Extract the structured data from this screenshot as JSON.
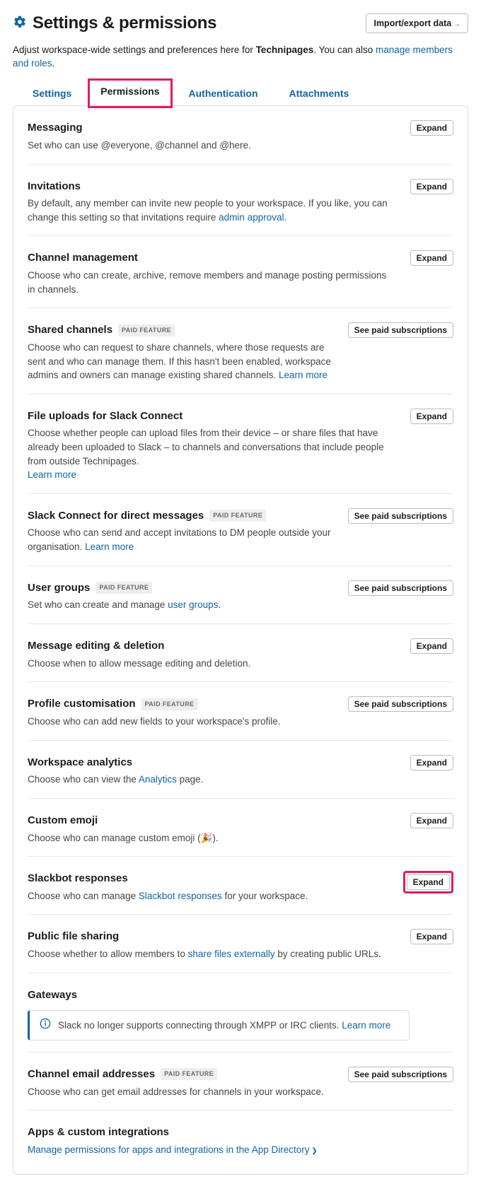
{
  "header": {
    "title": "Settings & permissions",
    "import_export_label": "Import/export data"
  },
  "subhead": {
    "prefix": "Adjust workspace-wide settings and preferences here for ",
    "workspace": "Technipages",
    "suffix": ". You can also ",
    "link": "manage members and roles",
    "period": "."
  },
  "tabs": {
    "settings": "Settings",
    "permissions": "Permissions",
    "authentication": "Authentication",
    "attachments": "Attachments"
  },
  "buttons": {
    "expand": "Expand",
    "see_paid": "See paid subscriptions"
  },
  "badges": {
    "paid": "PAID FEATURE"
  },
  "sections": {
    "messaging": {
      "title": "Messaging",
      "desc": "Set who can use @everyone, @channel and @here."
    },
    "invitations": {
      "title": "Invitations",
      "desc_before": "By default, any member can invite new people to your workspace. If you like, you can change this setting so that invitations require ",
      "link": "admin approval",
      "desc_after": "."
    },
    "channel_mgmt": {
      "title": "Channel management",
      "desc": "Choose who can create, archive, remove members and manage posting permissions in channels."
    },
    "shared_channels": {
      "title": "Shared channels",
      "desc_before": "Choose who can request to share channels, where those requests are sent and who can manage them. If this hasn't been enabled, workspace admins and owners can manage existing shared channels. ",
      "link": "Learn more"
    },
    "file_uploads": {
      "title": "File uploads for Slack Connect",
      "desc_before": "Choose whether people can upload files from their device – or share files that have already been uploaded to Slack – to channels and conversations that include people from outside ",
      "bold": "Technipages",
      "desc_after": ".",
      "link": "Learn more"
    },
    "slack_connect_dm": {
      "title": "Slack Connect for direct messages",
      "desc_before": "Choose who can send and accept invitations to DM people outside your organisation. ",
      "link": "Learn more"
    },
    "user_groups": {
      "title": "User groups",
      "desc_before": "Set who can create and manage ",
      "link": "user groups",
      "desc_after": "."
    },
    "msg_edit": {
      "title": "Message editing & deletion",
      "desc": "Choose when to allow message editing and deletion."
    },
    "profile": {
      "title": "Profile customisation",
      "desc": "Choose who can add new fields to your workspace's profile."
    },
    "analytics": {
      "title": "Workspace analytics",
      "desc_before": "Choose who can view the ",
      "link": "Analytics",
      "desc_after": " page."
    },
    "emoji": {
      "title": "Custom emoji",
      "desc": "Choose who can manage custom emoji (🎉)."
    },
    "slackbot": {
      "title": "Slackbot responses",
      "desc_before": "Choose who can manage ",
      "link": "Slackbot responses",
      "desc_after": " for your workspace."
    },
    "public_file": {
      "title": "Public file sharing",
      "desc_before": "Choose whether to allow members to ",
      "link": "share files externally",
      "desc_after": " by creating public URLs."
    },
    "gateways": {
      "title": "Gateways",
      "banner_text": "Slack no longer supports connecting through XMPP or IRC clients. ",
      "banner_link": "Learn more"
    },
    "channel_email": {
      "title": "Channel email addresses",
      "desc": "Choose who can get email addresses for channels in your workspace."
    },
    "apps": {
      "title": "Apps & custom integrations",
      "link": "Manage permissions for apps and integrations in the App Directory"
    }
  }
}
